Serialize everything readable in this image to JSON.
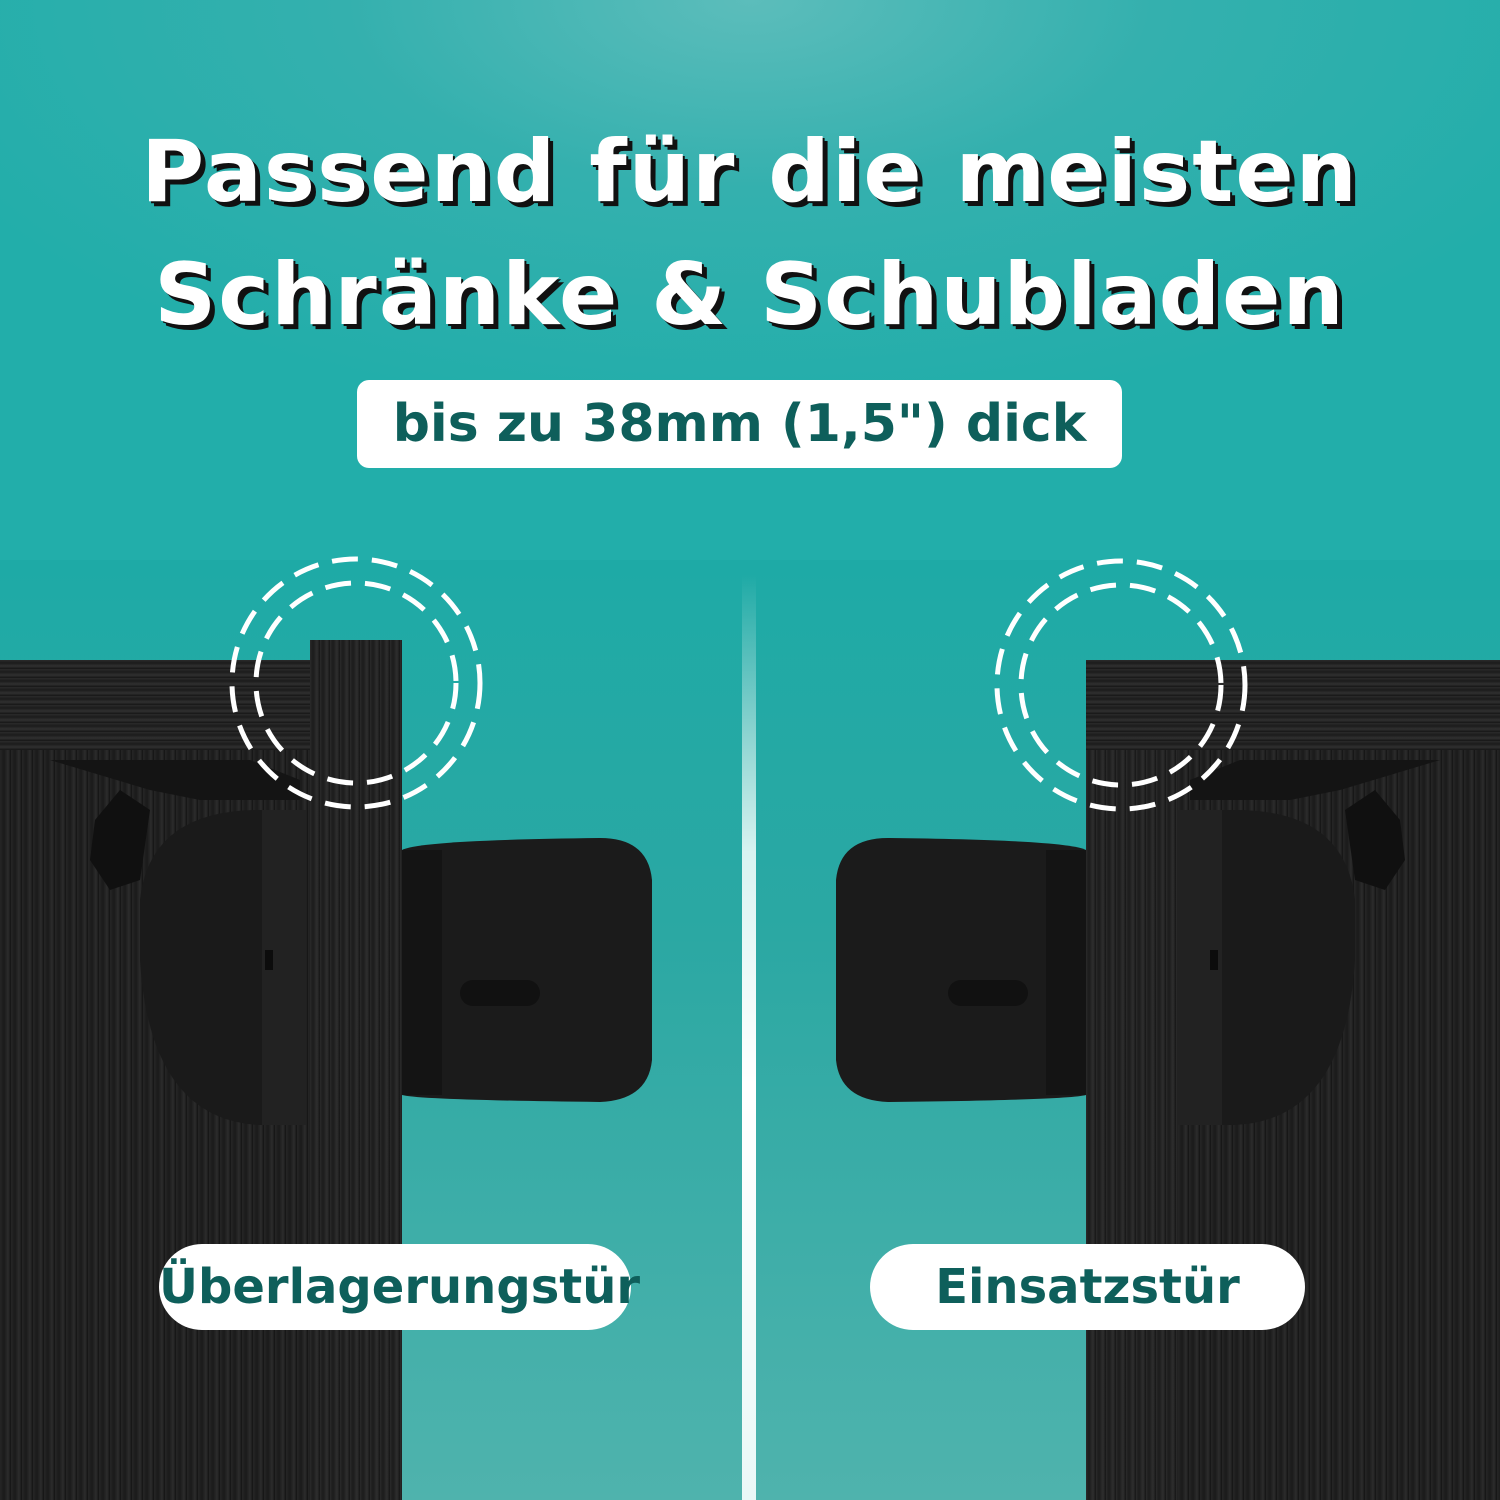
{
  "headline": {
    "line1": "Passend für die meisten",
    "line2": "Schränke & Schubladen"
  },
  "subtitle": "bis zu 38mm (1,5\") dick",
  "labels": {
    "left": "Überlagerungstür",
    "right": "Einsatzstür"
  },
  "colors": {
    "background": "#22aeaa",
    "pill_text": "#0e5f5b",
    "wood": "#1e1e1e"
  }
}
